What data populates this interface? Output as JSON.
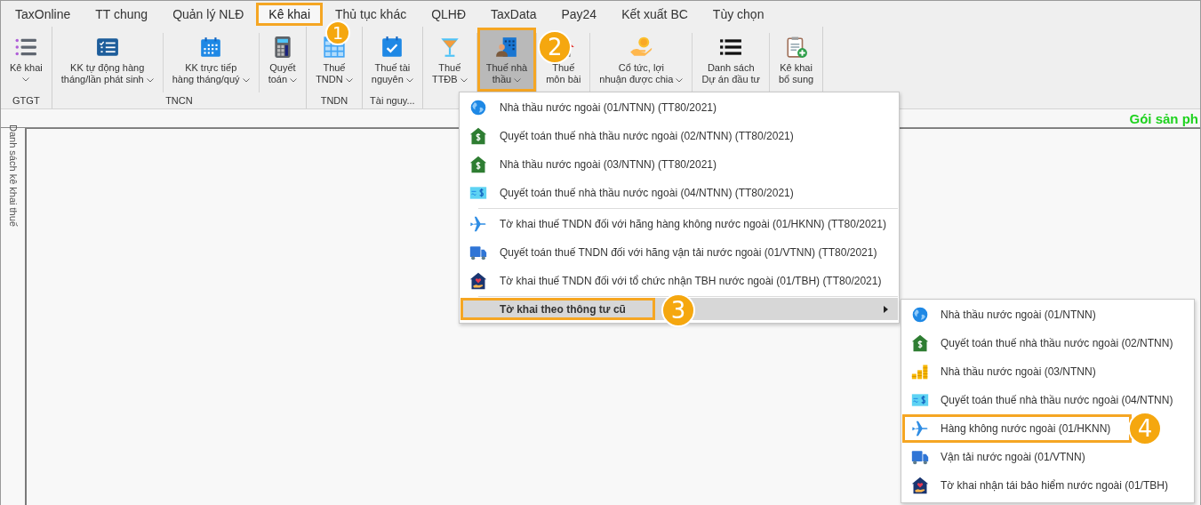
{
  "tabs": [
    {
      "label": "TaxOnline",
      "selected": false
    },
    {
      "label": "TT chung",
      "selected": false
    },
    {
      "label": "Quản lý NLĐ",
      "selected": false
    },
    {
      "label": "Kê khai",
      "selected": true,
      "callout": "1"
    },
    {
      "label": "Thủ tục khác",
      "selected": false
    },
    {
      "label": "QLHĐ",
      "selected": false
    },
    {
      "label": "TaxData",
      "selected": false
    },
    {
      "label": "Pay24",
      "selected": false
    },
    {
      "label": "Kết xuất BC",
      "selected": false
    },
    {
      "label": "Tùy chọn",
      "selected": false
    }
  ],
  "ribbon": {
    "groups": [
      {
        "label": "GTGT",
        "buttons": [
          {
            "label": "Kê khai",
            "kind": "numbered-list",
            "dropdown": true,
            "selected": false
          }
        ]
      },
      {
        "label": "TNCN",
        "buttons": [
          {
            "label": "KK tự động hàng\ntháng/lần phát sinh",
            "kind": "checklist",
            "dropdown": true,
            "selected": false
          },
          {
            "label": "KK trực tiếp\nhàng tháng/quý",
            "kind": "calendar",
            "dropdown": true,
            "selected": false
          },
          {
            "label": "Quyết\ntoán",
            "kind": "calculator",
            "dropdown": true,
            "selected": false
          }
        ]
      },
      {
        "label": "TNDN",
        "buttons": [
          {
            "label": "Thuế\nTNDN",
            "kind": "table",
            "dropdown": true,
            "selected": false
          }
        ]
      },
      {
        "label": "Tài nguy...",
        "buttons": [
          {
            "label": "Thuế tài\nnguyên",
            "kind": "checkbox",
            "dropdown": true,
            "selected": false
          }
        ]
      },
      {
        "buttons": [
          {
            "label": "Thuế\nTTĐB",
            "kind": "cocktail",
            "dropdown": true,
            "selected": false
          },
          {
            "label": "Thuế nhà\nthầu",
            "kind": "building-person",
            "dropdown": true,
            "selected": true,
            "callout": "2"
          },
          {
            "label": "Thuế\nmôn bài",
            "kind": "house",
            "dropdown": false,
            "selected": false
          },
          {
            "label": "Cổ tức, lợi\nnhuận được chia",
            "kind": "coin-hand",
            "dropdown": true,
            "selected": false
          },
          {
            "label": "Danh sách\nDự án đầu tư",
            "kind": "bullet-list",
            "dropdown": false,
            "selected": false
          },
          {
            "label": "Kê khai\nbổ sung",
            "kind": "clipboard-plus",
            "dropdown": false,
            "selected": false
          }
        ]
      }
    ]
  },
  "package_label": "Gói sản ph",
  "sidebar": {
    "title": "Danh sách kê khai thuế"
  },
  "menu": {
    "sections": [
      [
        {
          "label": "Nhà thầu nước ngoài (01/NTNN) (TT80/2021)",
          "kind": "globe",
          "selected": false
        },
        {
          "label": "Quyết toán thuế nhà thầu nước ngoài (02/NTNN) (TT80/2021)",
          "kind": "house-dollar",
          "selected": false
        },
        {
          "label": "Nhà thầu nước ngoài (03/NTNN) (TT80/2021)",
          "kind": "house-dollar",
          "selected": false
        },
        {
          "label": "Quyết toán thuế nhà thầu nước ngoài (04/NTNN) (TT80/2021)",
          "kind": "bill",
          "selected": false
        }
      ],
      [
        {
          "label": "Tờ khai thuế TNDN đối với hãng hàng không nước ngoài (01/HKNN) (TT80/2021)",
          "kind": "plane",
          "selected": false
        },
        {
          "label": "Quyết toán thuế TNDN đối với hãng vận tải nước ngoài (01/VTNN) (TT80/2021)",
          "kind": "truck",
          "selected": false
        },
        {
          "label": "Tờ khai thuế TNDN đối với tổ chức nhận TBH nước ngoài (01/TBH) (TT80/2021)",
          "kind": "house-heart",
          "selected": false
        }
      ],
      [
        {
          "label": "Tờ khai theo thông tư cũ",
          "has_submenu": true,
          "selected": true,
          "callout": "3"
        }
      ]
    ]
  },
  "submenu": {
    "items": [
      {
        "label": "Nhà thầu nước ngoài (01/NTNN)",
        "kind": "globe",
        "selected": false
      },
      {
        "label": "Quyết toán thuế nhà thầu nước ngoài (02/NTNN)",
        "kind": "house-dollar",
        "selected": false
      },
      {
        "label": "Nhà thầu nước ngoài (03/NTNN)",
        "kind": "coins",
        "selected": false
      },
      {
        "label": "Quyết toán thuế nhà thầu nước ngoài (04/NTNN)",
        "kind": "bill",
        "selected": false
      },
      {
        "label": "Hàng không nước ngoài (01/HKNN)",
        "kind": "plane",
        "selected": false,
        "callout": "4"
      },
      {
        "label": "Vận tải nước ngoài (01/VTNN)",
        "kind": "truck",
        "selected": false
      },
      {
        "label": "Tờ khai nhận tái bảo hiểm nước ngoài (01/TBH)",
        "kind": "house-heart",
        "selected": false
      }
    ]
  }
}
